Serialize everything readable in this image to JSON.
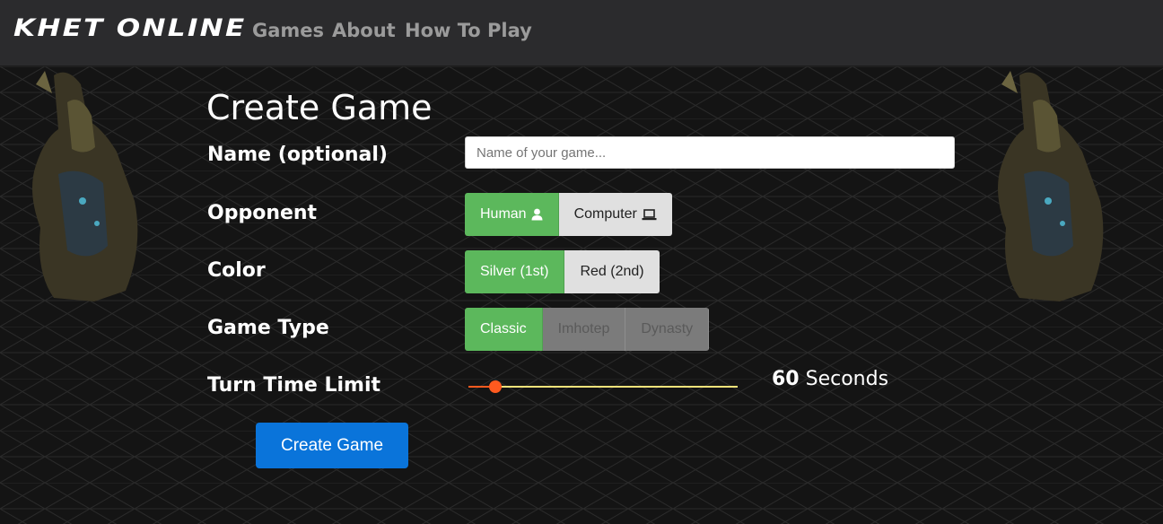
{
  "navbar": {
    "logo": "Khet Online",
    "links": [
      "Games",
      "About",
      "How To Play"
    ]
  },
  "form": {
    "title": "Create Game",
    "name": {
      "label": "Name (optional)",
      "value": "",
      "placeholder": "Name of your game..."
    },
    "opponent": {
      "label": "Opponent",
      "options": [
        {
          "label": "Human",
          "icon": "user-icon",
          "selected": true
        },
        {
          "label": "Computer",
          "icon": "laptop-icon",
          "selected": false
        }
      ]
    },
    "color": {
      "label": "Color",
      "options": [
        {
          "label": "Silver (1st)",
          "selected": true
        },
        {
          "label": "Red (2nd)",
          "selected": false
        }
      ]
    },
    "game_type": {
      "label": "Game Type",
      "options": [
        {
          "label": "Classic",
          "selected": true,
          "disabled": false
        },
        {
          "label": "Imhotep",
          "selected": false,
          "disabled": true
        },
        {
          "label": "Dynasty",
          "selected": false,
          "disabled": true
        }
      ]
    },
    "turn_time": {
      "label": "Turn Time Limit",
      "value": "60",
      "unit": "Seconds",
      "fraction": 0.1
    },
    "submit_label": "Create Game"
  },
  "colors": {
    "navbar_bg": "#2b2b2d",
    "page_bg": "#141414",
    "selected_green": "#5cb85c",
    "primary_blue": "#0a74da",
    "slider_active": "#ff5a1f",
    "slider_track": "#f2e27a"
  }
}
